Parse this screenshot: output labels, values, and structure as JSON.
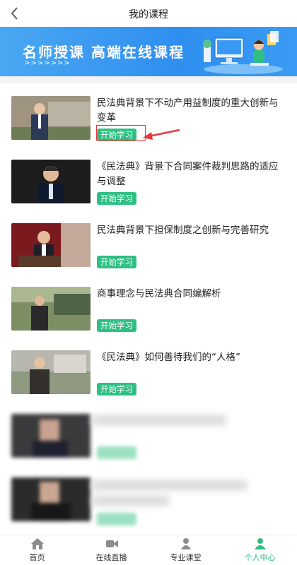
{
  "header": {
    "title": "我的课程"
  },
  "banner": {
    "text": "名师授课  高端在线课程",
    "arrows": ">>>>>>>"
  },
  "courses": [
    {
      "title": "民法典背景下不动产用益制度的重大创新与变革",
      "button": "开始学习"
    },
    {
      "title": "《民法典》背景下合同案件裁判思路的适应与调整",
      "button": "开始学习"
    },
    {
      "title": "民法典背景下担保制度之创新与完善研究",
      "button": "开始学习"
    },
    {
      "title": "商事理念与民法典合同编解析",
      "button": "开始学习"
    },
    {
      "title": "《民法典》如何善待我们的“人格”",
      "button": "开始学习"
    }
  ],
  "tabbar": {
    "items": [
      {
        "label": "首页",
        "icon": "home-icon"
      },
      {
        "label": "在线直播",
        "icon": "video-icon"
      },
      {
        "label": "专业课堂",
        "icon": "classroom-icon"
      },
      {
        "label": "个人中心",
        "icon": "user-icon"
      }
    ],
    "active_color": "#2fbf83"
  },
  "colors": {
    "accent": "#2fbf83",
    "banner": "#2f8ff0",
    "highlight": "#e8383d"
  }
}
